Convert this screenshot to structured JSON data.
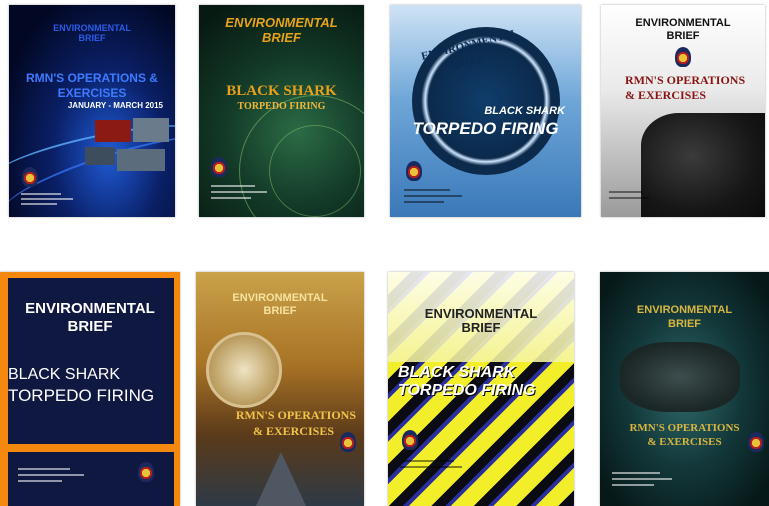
{
  "covers": [
    {
      "title": "ENVIRONMENTAL BRIEF",
      "headline": "RMN'S OPERATIONS & EXERCISES",
      "subtitle": "JANUARY - MARCH 2015"
    },
    {
      "title": "ENVIRONMENTAL BRIEF",
      "headline1": "BLACK SHARK",
      "headline2": "TORPEDO FIRING"
    },
    {
      "title1": "ENVIRONMENTAL",
      "title2": "BRIEF",
      "headline1": "BLACK SHARK",
      "headline2": "TORPEDO FIRING"
    },
    {
      "title1": "ENVIRONMENTAL",
      "title2": "BRIEF",
      "headline1": "RMN'S OPERATIONS",
      "headline2": "& EXERCISES"
    },
    {
      "title1": "ENVIRONMENTAL",
      "title2": "BRIEF",
      "headline1": "BLACK SHARK",
      "headline2": "TORPEDO FIRING"
    },
    {
      "title1": "ENVIRONMENTAL",
      "title2": "BRIEF",
      "headline1": "RMN'S OPERATIONS",
      "headline2": "& EXERCISES"
    },
    {
      "title1": "ENVIRONMENTAL",
      "title2": "BRIEF",
      "headline1": "BLACK SHARK",
      "headline2": "TORPEDO FIRING"
    },
    {
      "title1": "ENVIRONMENTAL",
      "title2": "BRIEF",
      "headline1": "RMN'S OPERATIONS",
      "headline2": "& EXERCISES"
    }
  ]
}
